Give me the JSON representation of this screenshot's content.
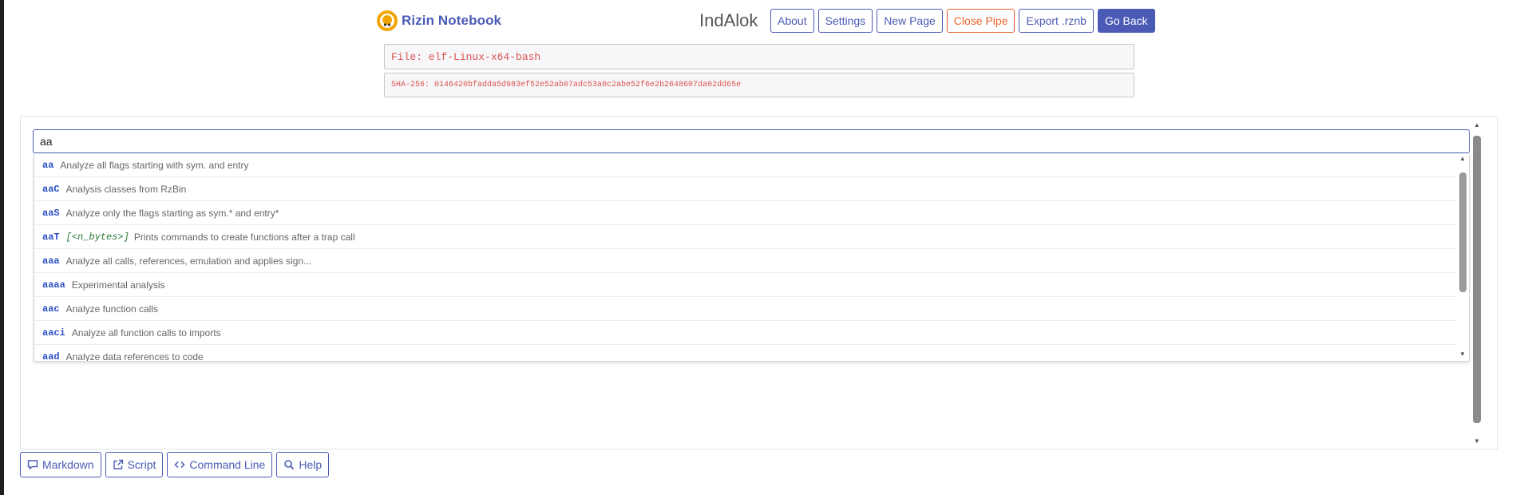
{
  "header": {
    "brand": "Rizin Notebook",
    "page_name": "IndAlok",
    "nav": [
      {
        "label": "About"
      },
      {
        "label": "Settings"
      },
      {
        "label": "New Page"
      },
      {
        "label": "Close Pipe"
      },
      {
        "label": "Export .rznb"
      },
      {
        "label": "Go Back"
      }
    ]
  },
  "file": {
    "name": "File: elf-Linux-x64-bash",
    "sha": "SHA-256: 0146420bfadda5d983ef52e52ab07adc53a0c2abe52f6e2b2648607da02dd65e"
  },
  "command": {
    "value": "aa"
  },
  "suggestions": [
    {
      "cmd": "aa",
      "args": "",
      "desc": "Analyze all flags starting with sym. and entry"
    },
    {
      "cmd": "aaC",
      "args": "",
      "desc": "Analysis classes from RzBin"
    },
    {
      "cmd": "aaS",
      "args": "",
      "desc": "Analyze only the flags starting as sym.* and entry*"
    },
    {
      "cmd": "aaT",
      "args": "[<n_bytes>]",
      "desc": "Prints commands to create functions after a trap call"
    },
    {
      "cmd": "aaa",
      "args": "",
      "desc": "Analyze all calls, references, emulation and applies sign..."
    },
    {
      "cmd": "aaaa",
      "args": "",
      "desc": "Experimental analysis"
    },
    {
      "cmd": "aac",
      "args": "",
      "desc": "Analyze function calls"
    },
    {
      "cmd": "aaci",
      "args": "",
      "desc": "Analyze all function calls to imports"
    },
    {
      "cmd": "aad",
      "args": "",
      "desc": "Analyze data references to code"
    }
  ],
  "toolbar": [
    {
      "label": "Markdown",
      "icon": "comment-icon"
    },
    {
      "label": "Script",
      "icon": "external-link-icon"
    },
    {
      "label": "Command Line",
      "icon": "code-icon"
    },
    {
      "label": "Help",
      "icon": "search-icon"
    }
  ],
  "colors": {
    "accent": "#4b5bb5",
    "danger": "#e8622b",
    "mono_red": "#d9534f",
    "cmd_blue": "#2b50c4",
    "args_green": "#2a7a3a"
  }
}
